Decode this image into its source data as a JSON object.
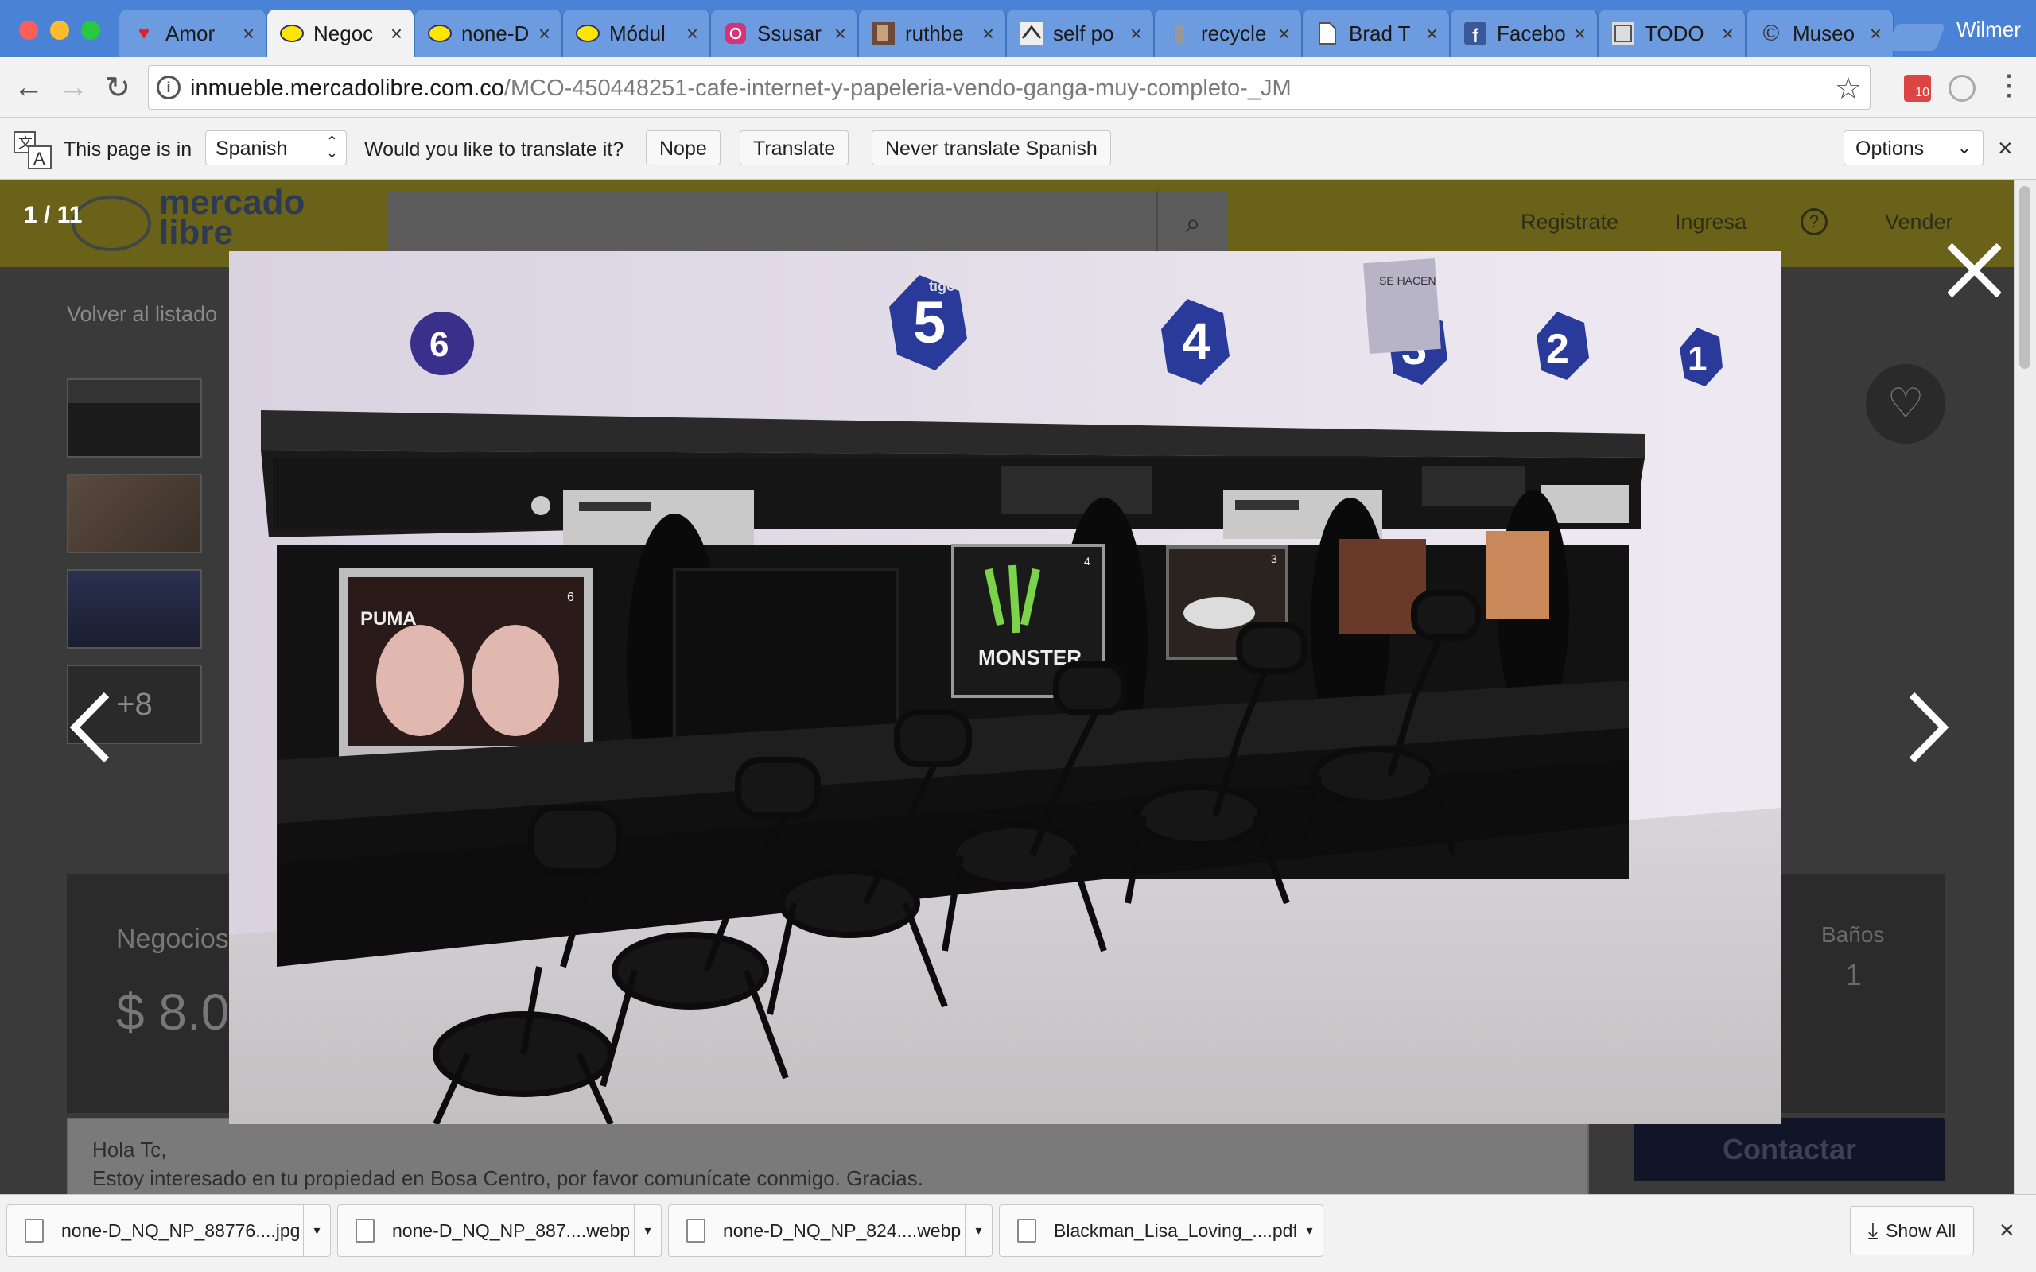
{
  "browser": {
    "profile_name": "Wilmer",
    "tabs": [
      {
        "label": "Amor",
        "icon": "heart-icon",
        "active": false
      },
      {
        "label": "Negoc",
        "icon": "mercadolibre-icon",
        "active": true
      },
      {
        "label": "none-D",
        "icon": "mercadolibre-icon",
        "active": false
      },
      {
        "label": "Módul",
        "icon": "mercadolibre-icon",
        "active": false
      },
      {
        "label": "Ssusar",
        "icon": "instagram-icon",
        "active": false
      },
      {
        "label": "ruthbe",
        "icon": "image-icon",
        "active": false
      },
      {
        "label": "self po",
        "icon": "image-icon",
        "active": false
      },
      {
        "label": "recycle",
        "icon": "image-icon",
        "active": false
      },
      {
        "label": "Brad T",
        "icon": "document-icon",
        "active": false
      },
      {
        "label": "Facebo",
        "icon": "facebook-icon",
        "active": false
      },
      {
        "label": "TODO",
        "icon": "image-icon",
        "active": false
      },
      {
        "label": "Museo",
        "icon": "copyright-icon",
        "active": false
      }
    ],
    "tab_close": "×",
    "url_host": "inmueble.mercadolibre.com.co",
    "url_path": "/MCO-450448251-cafe-internet-y-papeleria-vendo-ganga-muy-completo-_JM",
    "extension_badge": "10"
  },
  "translate_bar": {
    "prefix": "This page is in",
    "language": "Spanish",
    "question": "Would you like to translate it?",
    "nope": "Nope",
    "translate": "Translate",
    "never": "Never translate Spanish",
    "options": "Options",
    "close": "×"
  },
  "page": {
    "logo_text_line1": "mercado",
    "logo_text_line2": "libre",
    "nav": [
      "Registrate",
      "Ingresa",
      "?",
      "Vender"
    ],
    "back_link": "Volver al listado",
    "more_thumbs": "+8",
    "category": "Negocios",
    "price": "$ 8.0",
    "baths_label": "Baños",
    "baths_value": "1",
    "message_line1": "Hola Tc,",
    "message_line2": "Estoy interesado en tu propiedad en Bosa Centro, por favor comunícate conmigo. Gracias.",
    "contact_button": "Contactar"
  },
  "lightbox": {
    "counter": "1 / 11",
    "photo_text": {
      "monster": "MONSTER",
      "puma": "PUMA",
      "screen_numbers": [
        "6",
        "4",
        "3"
      ],
      "station_numbers": [
        "6",
        "5",
        "4",
        "3",
        "2",
        "1"
      ],
      "sign_header": "SE HACEN",
      "tigo": "tigo"
    }
  },
  "downloads": {
    "items": [
      {
        "name": "none-D_NQ_NP_88776....jpg",
        "icon": "image-file-icon"
      },
      {
        "name": "none-D_NQ_NP_887....webp",
        "icon": "file-icon"
      },
      {
        "name": "none-D_NQ_NP_824....webp",
        "icon": "file-icon"
      },
      {
        "name": "Blackman_Lisa_Loving_....pdf",
        "icon": "pdf-file-icon"
      }
    ],
    "dropdown": "▾",
    "show_all": "Show All",
    "close": "×"
  },
  "colors": {
    "tabstrip": "#4a83d6",
    "mercadolibre_header": "#6a6219",
    "overlay": "#1e1e1e"
  }
}
